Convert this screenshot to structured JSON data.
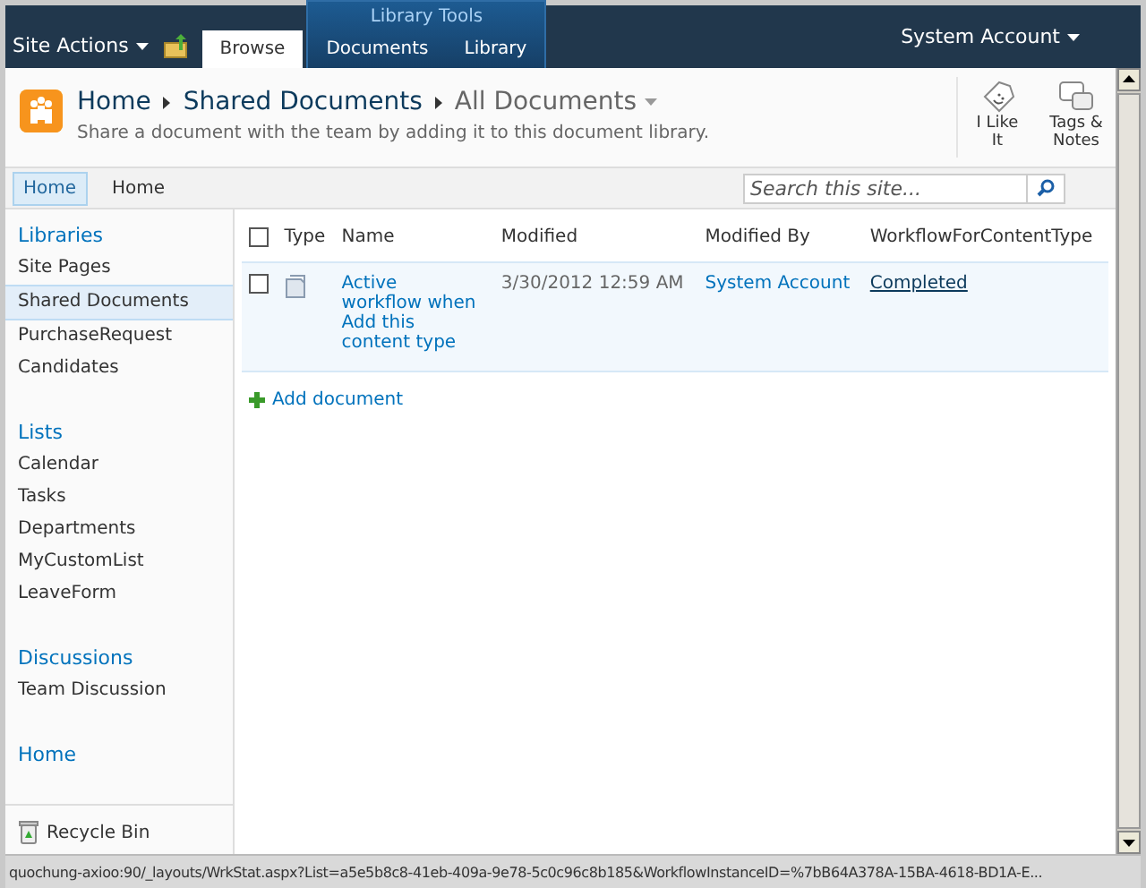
{
  "top_bar": {
    "site_actions": "Site Actions",
    "tabs": [
      {
        "label": "Browse",
        "selected": true
      }
    ],
    "library_tools": {
      "title": "Library Tools",
      "tabs": [
        {
          "label": "Documents",
          "selected": false
        },
        {
          "label": "Library",
          "selected": false
        }
      ]
    },
    "user": "System Account"
  },
  "header": {
    "breadcrumb": [
      "Home",
      "Shared Documents",
      "All Documents"
    ],
    "description": "Share a document with the team by adding it to this document library.",
    "actions": [
      {
        "kind": "like",
        "label": "I Like It"
      },
      {
        "kind": "tags",
        "label": "Tags & Notes"
      }
    ]
  },
  "nav": {
    "items": [
      {
        "label": "Home",
        "selected": true
      },
      {
        "label": "Home",
        "selected": false
      }
    ],
    "search": {
      "placeholder": "Search this site..."
    }
  },
  "sidebar": {
    "sections": [
      {
        "heading": "Libraries",
        "items": [
          {
            "label": "Site Pages",
            "selected": false
          },
          {
            "label": "Shared Documents",
            "selected": true
          },
          {
            "label": "PurchaseRequest",
            "selected": false
          },
          {
            "label": "Candidates",
            "selected": false
          }
        ]
      },
      {
        "heading": "Lists",
        "items": [
          {
            "label": "Calendar",
            "selected": false
          },
          {
            "label": "Tasks",
            "selected": false
          },
          {
            "label": "Departments",
            "selected": false
          },
          {
            "label": "MyCustomList",
            "selected": false
          },
          {
            "label": "LeaveForm",
            "selected": false
          }
        ]
      },
      {
        "heading": "Discussions",
        "items": [
          {
            "label": "Team Discussion",
            "selected": false
          }
        ]
      },
      {
        "heading": "Home"
      }
    ],
    "footer": [
      {
        "label": "Recycle Bin"
      }
    ]
  },
  "table": {
    "columns": [
      "Type",
      "Name",
      "Modified",
      "Modified By",
      "WorkflowForContentType"
    ],
    "select_all": {
      "checked": false
    },
    "rows": [
      {
        "checked": false,
        "selected": true,
        "name": "Active workflow when Add this content type",
        "modified": "3/30/2012 12:59 AM",
        "modified_by": "System Account",
        "workflow": "Completed"
      }
    ]
  },
  "add_link": "Add document",
  "status_bar": "quochung-axioo:90/_layouts/WrkStat.aspx?List=a5e5b8c8-41eb-409a-9e78-5c0c96c8b185&WorkflowInstanceID=%7bB64A378A-15BA-4618-BD1A-E..."
}
